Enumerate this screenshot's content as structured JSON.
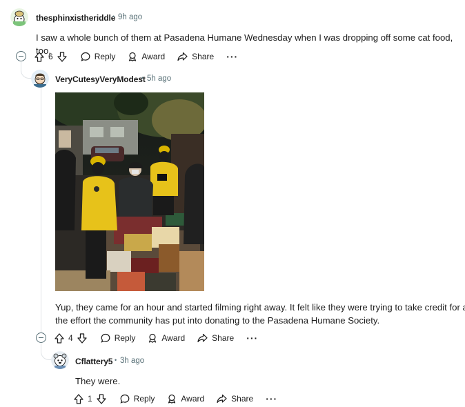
{
  "comments": [
    {
      "username": "thesphinxistheriddle",
      "time": "9h ago",
      "text": "I saw a whole bunch of them at Pasadena Humane Wednesday when I was dropping off some cat food, too.",
      "votes": "6",
      "reply_label": "Reply",
      "award_label": "Award",
      "share_label": "Share",
      "more_label": "···"
    },
    {
      "username": "VeryCutesyVeryModest",
      "time": "5h ago",
      "text_line1": "Yup, they came for an hour and started filming right away. It felt like they were trying to take credit for all",
      "text_line2": "the effort the community has put into donating to the Pasadena Humane Society.",
      "votes": "4",
      "reply_label": "Reply",
      "award_label": "Award",
      "share_label": "Share",
      "more_label": "···"
    },
    {
      "username": "Cflattery5",
      "time": "3h ago",
      "text": "They were.",
      "votes": "1",
      "reply_label": "Reply",
      "award_label": "Award",
      "share_label": "Share",
      "more_label": "···"
    }
  ],
  "separator": "•",
  "icons": {
    "upvote": "arrow-up-icon",
    "downvote": "arrow-down-icon",
    "reply": "speech-bubble-icon",
    "award": "award-ribbon-icon",
    "share": "share-arrow-icon",
    "collapse": "collapse-minus-icon"
  }
}
